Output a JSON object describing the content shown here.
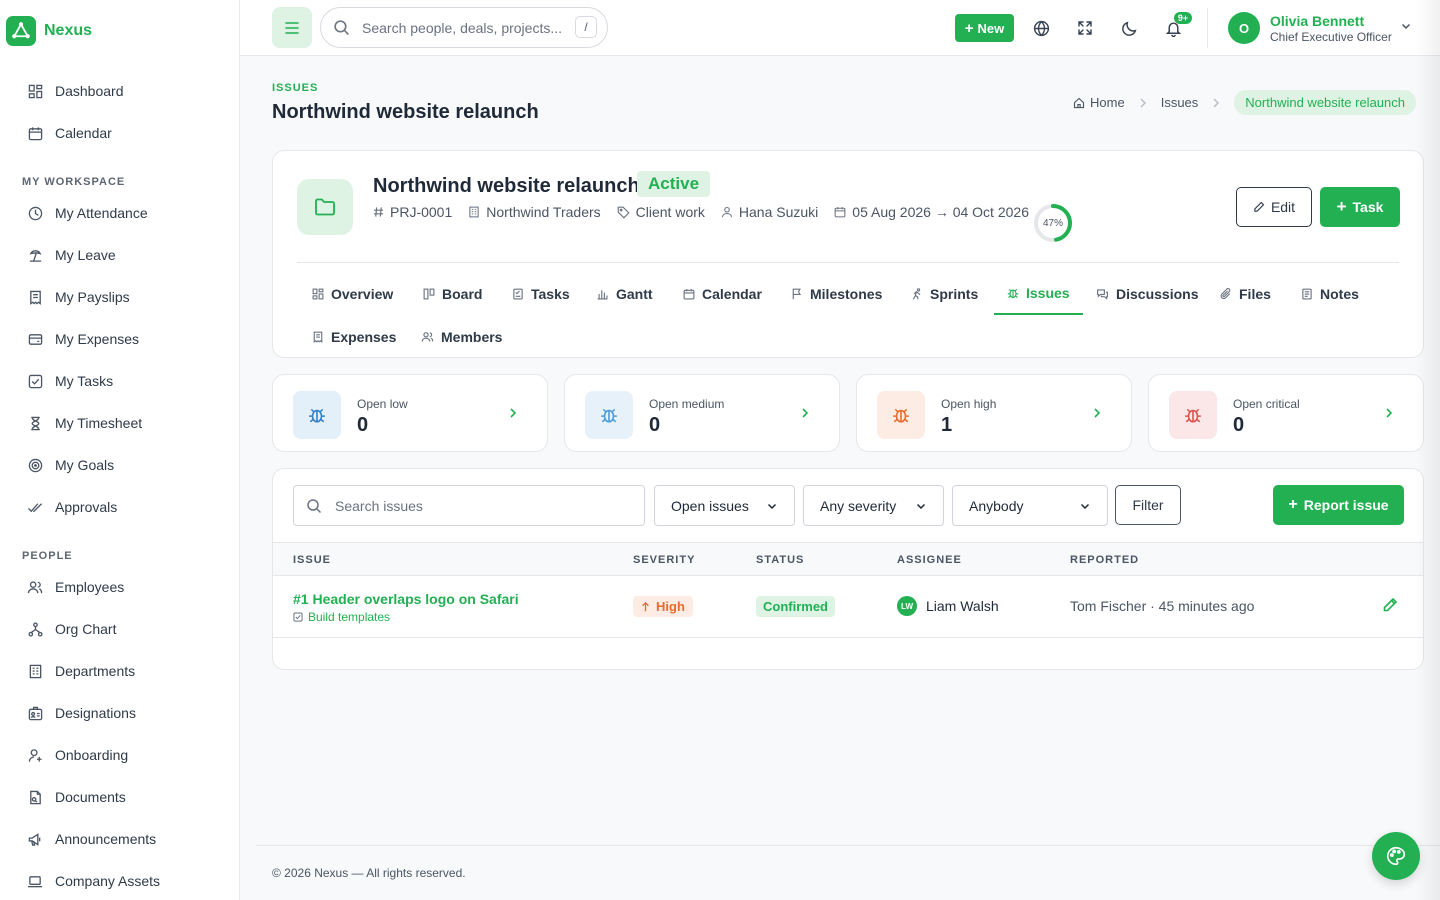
{
  "brand": {
    "name": "Nexus"
  },
  "sidebar": {
    "top_items": [
      {
        "label": "Dashboard",
        "icon": "dashboard-icon"
      },
      {
        "label": "Calendar",
        "icon": "calendar-icon"
      }
    ],
    "workspace_title": "MY WORKSPACE",
    "workspace_items": [
      {
        "label": "My Attendance",
        "icon": "clock-icon"
      },
      {
        "label": "My Leave",
        "icon": "beach-icon"
      },
      {
        "label": "My Payslips",
        "icon": "receipt-icon"
      },
      {
        "label": "My Expenses",
        "icon": "wallet-icon"
      },
      {
        "label": "My Tasks",
        "icon": "checkbox-icon"
      },
      {
        "label": "My Timesheet",
        "icon": "hourglass-icon"
      },
      {
        "label": "My Goals",
        "icon": "target-icon"
      },
      {
        "label": "Approvals",
        "icon": "double-check-icon"
      }
    ],
    "people_title": "PEOPLE",
    "people_items": [
      {
        "label": "Employees",
        "icon": "users-icon"
      },
      {
        "label": "Org Chart",
        "icon": "hierarchy-icon"
      },
      {
        "label": "Departments",
        "icon": "building-icon"
      },
      {
        "label": "Designations",
        "icon": "id-badge-icon"
      },
      {
        "label": "Onboarding",
        "icon": "user-plus-icon"
      },
      {
        "label": "Documents",
        "icon": "document-icon"
      },
      {
        "label": "Announcements",
        "icon": "megaphone-icon"
      },
      {
        "label": "Company Assets",
        "icon": "laptop-icon"
      }
    ]
  },
  "topbar": {
    "search_placeholder": "Search people, deals, projects...",
    "search_shortcut": "/",
    "new_label": "New",
    "notification_count": "9+",
    "user_initial": "O",
    "user_name": "Olivia Bennett",
    "user_role": "Chief Executive Officer"
  },
  "page": {
    "eyebrow": "ISSUES",
    "title": "Northwind website relaunch",
    "breadcrumb": [
      "Home",
      "Issues",
      "Northwind website relaunch"
    ]
  },
  "project": {
    "name": "Northwind website relaunch",
    "status": "Active",
    "code": "PRJ-0001",
    "client": "Northwind Traders",
    "category": "Client work",
    "owner": "Hana Suzuki",
    "dates": "05 Aug 2026 → 04 Oct 2026",
    "progress": 47,
    "progress_label": "47%",
    "edit_label": "Edit",
    "task_label": "Task",
    "tabs": [
      "Overview",
      "Board",
      "Tasks",
      "Gantt",
      "Calendar",
      "Milestones",
      "Sprints",
      "Issues",
      "Discussions",
      "Files",
      "Notes",
      "Expenses",
      "Members"
    ],
    "active_tab": "Issues"
  },
  "stats": [
    {
      "label": "Open low",
      "value": "0",
      "color": "#2f80c9",
      "bg": "#e3eff9"
    },
    {
      "label": "Open medium",
      "value": "0",
      "color": "#4a9ad6",
      "bg": "#e6f1fa"
    },
    {
      "label": "Open high",
      "value": "1",
      "color": "#ea6a2b",
      "bg": "#fdece3"
    },
    {
      "label": "Open critical",
      "value": "0",
      "color": "#d9534f",
      "bg": "#fbe7e7"
    }
  ],
  "issues": {
    "search_placeholder": "Search issues",
    "status_filter": "Open issues",
    "severity_filter": "Any severity",
    "assignee_filter": "Anybody",
    "filter_label": "Filter",
    "report_label": "Report issue",
    "columns": [
      "ISSUE",
      "SEVERITY",
      "STATUS",
      "ASSIGNEE",
      "REPORTED"
    ],
    "rows": [
      {
        "title": "#1 Header overlaps logo on Safari",
        "task": "Build templates",
        "severity": "High",
        "status": "Confirmed",
        "assignee_initials": "LW",
        "assignee": "Liam Walsh",
        "reported": "Tom Fischer · 45 minutes ago"
      }
    ]
  },
  "footer": {
    "text": "© 2026 Nexus — All rights reserved."
  },
  "colors": {
    "accent": "#22b052",
    "accent_soft": "#dff3e5"
  }
}
